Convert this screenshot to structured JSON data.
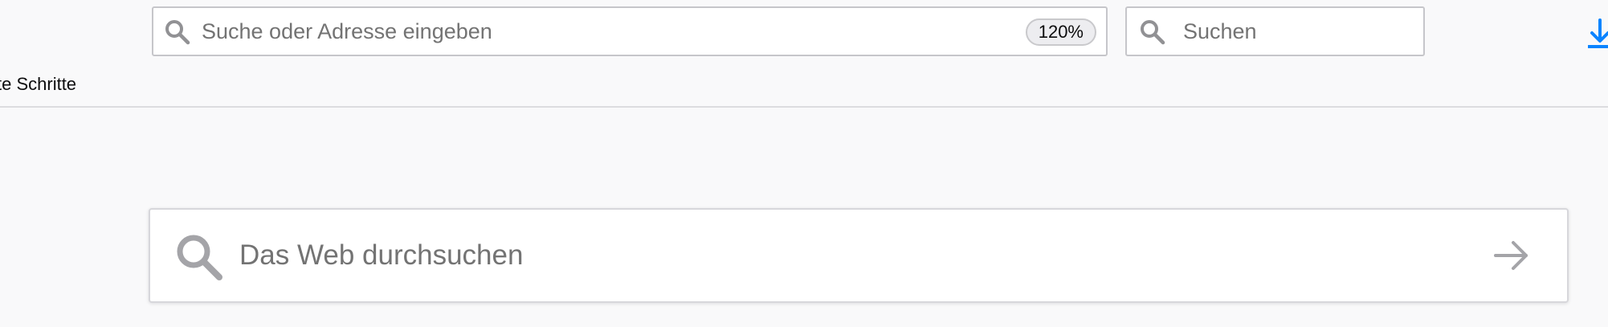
{
  "toolbar": {
    "urlbar": {
      "placeholder": "Suche oder Adresse eingeben",
      "zoom_level": "120%"
    },
    "searchbar": {
      "placeholder": "Suchen"
    },
    "download_icon": "download-arrow-icon",
    "accent_color": "#0a84ff"
  },
  "bookmarks": {
    "items": [
      {
        "label": "te Schritte"
      }
    ]
  },
  "newtab": {
    "search": {
      "placeholder": "Das Web durchsuchen",
      "icon": "search-icon",
      "go_icon": "arrow-right-icon"
    }
  },
  "colors": {
    "background": "#f9f9fa",
    "field": "#ffffff",
    "placeholder": "#737373",
    "icon": "#a4a4a8"
  }
}
